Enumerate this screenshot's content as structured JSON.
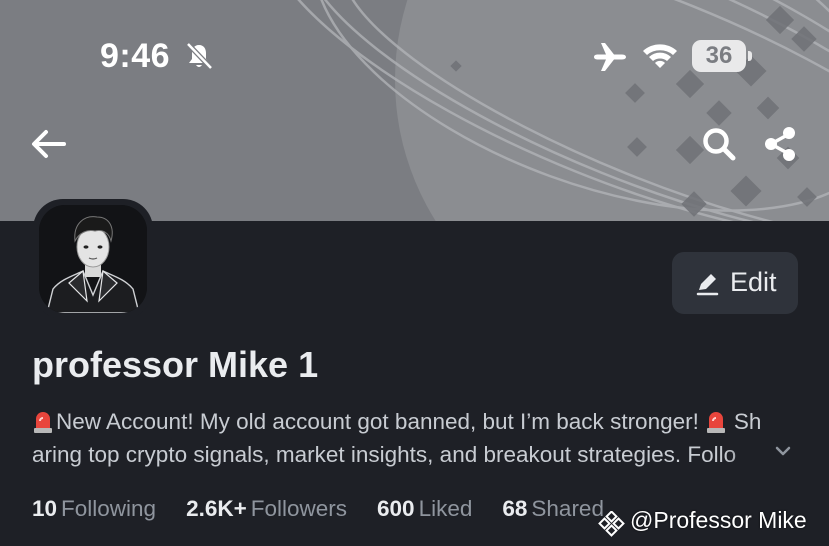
{
  "status_bar": {
    "time": "9:46",
    "battery": "36",
    "icons": [
      "bell-muted-icon",
      "airplane-icon",
      "wifi-icon",
      "battery-icon"
    ]
  },
  "top_nav": {
    "icons": [
      "back-arrow-icon",
      "search-icon",
      "share-icon"
    ]
  },
  "profile": {
    "name": "professor Mike 1",
    "edit_label": "Edit",
    "bio_line_1": "New Account! My old account got banned, but I’m back stronger!",
    "bio_line_1_tail": "Sh",
    "bio_line_2": "aring top crypto signals, market insights, and breakout strategies. Follo"
  },
  "stats": [
    {
      "value": "10",
      "label": "Following"
    },
    {
      "value": "2.6K+",
      "label": "Followers"
    },
    {
      "value": "600",
      "label": "Liked"
    },
    {
      "value": "68",
      "label": "Shared"
    }
  ],
  "watermark": {
    "text": "@Professor Mike"
  },
  "colors": {
    "background": "#1e2026",
    "banner": "#7b7d82",
    "button": "#2f333b",
    "text_primary": "#eaecef",
    "text_secondary": "#8f959e"
  }
}
